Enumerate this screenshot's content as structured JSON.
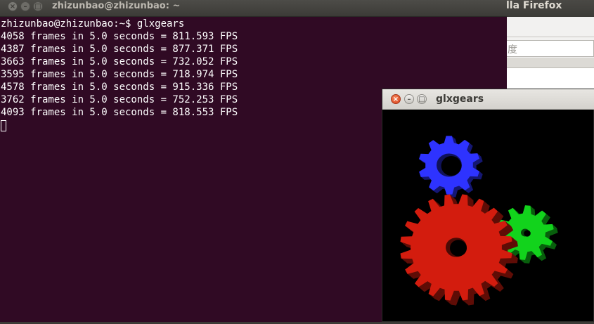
{
  "firefox": {
    "title": "lla Firefox",
    "search_text": "度"
  },
  "terminal": {
    "title": "zhizunbao@zhizunbao: ~",
    "buttons": {
      "close": "×",
      "minimize": "–",
      "maximize": "□"
    },
    "lines": [
      "zhizunbao@zhizunbao:~$ glxgears",
      "4058 frames in 5.0 seconds = 811.593 FPS",
      "4387 frames in 5.0 seconds = 877.371 FPS",
      "3663 frames in 5.0 seconds = 732.052 FPS",
      "3595 frames in 5.0 seconds = 718.974 FPS",
      "4578 frames in 5.0 seconds = 915.336 FPS",
      "3762 frames in 5.0 seconds = 752.253 FPS",
      "4093 frames in 5.0 seconds = 818.553 FPS"
    ]
  },
  "glxgears": {
    "title": "glxgears",
    "buttons": {
      "close": "×",
      "minimize": "–",
      "maximize": "□"
    },
    "gear_colors": {
      "blue": "#2e33ff",
      "red": "#d31c0e",
      "green": "#12d31c"
    }
  },
  "colors": {
    "terminal_bg": "#300a24",
    "titlebar_dark": "#3c3b37",
    "close_accent": "#e95420"
  }
}
